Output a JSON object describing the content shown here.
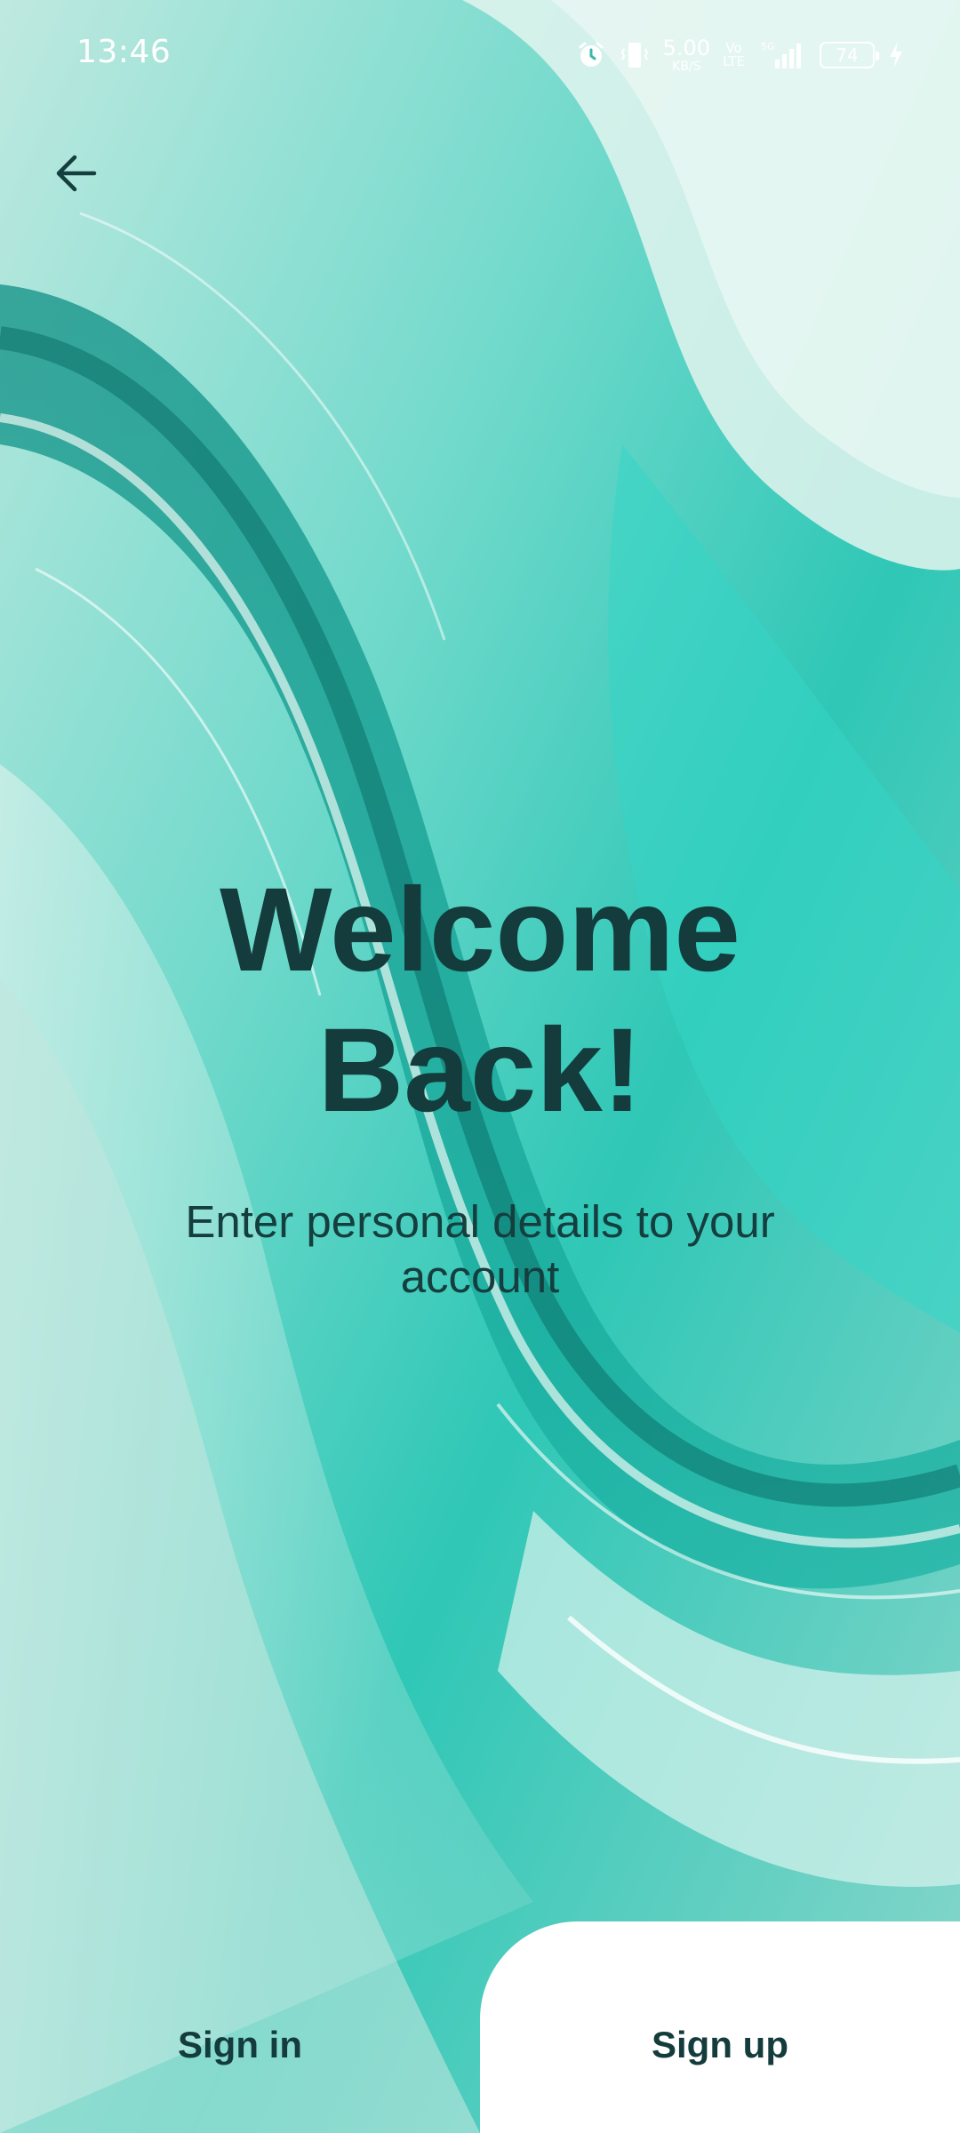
{
  "status_bar": {
    "time": "13:46",
    "net_speed_value": "5.00",
    "net_speed_unit": "KB/S",
    "volte_top": "Vo",
    "volte_bottom": "LTE",
    "network_type": "5G",
    "battery_level": "74",
    "icons": [
      "alarm-icon",
      "vibrate-icon",
      "signal-icon",
      "charging-icon"
    ]
  },
  "header": {
    "back_icon": "arrow-left-icon"
  },
  "hero": {
    "title_line1": "Welcome",
    "title_line2": "Back!",
    "subtitle": "Enter personal details to your account"
  },
  "bottom_nav": {
    "signin_label": "Sign in",
    "signup_label": "Sign up"
  },
  "colors": {
    "text_dark": "#143c3c",
    "background_teal": "#4fcfc0",
    "panel_white": "#ffffff"
  }
}
